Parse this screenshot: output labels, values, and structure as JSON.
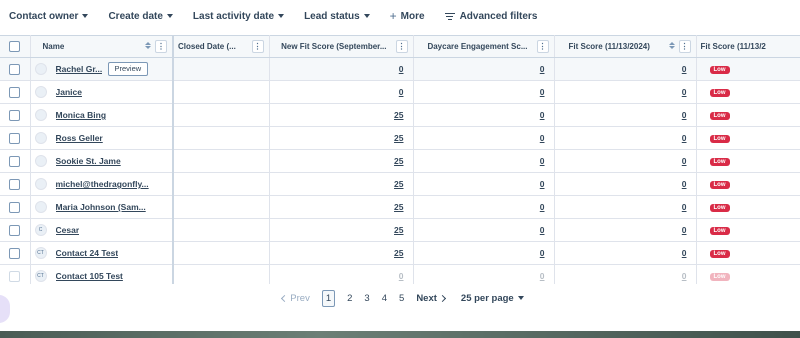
{
  "filters": [
    {
      "label": "Contact owner"
    },
    {
      "label": "Create date"
    },
    {
      "label": "Last activity date"
    },
    {
      "label": "Lead status"
    }
  ],
  "more_label": "More",
  "more_icon": "plus-icon",
  "advanced_label": "Advanced filters",
  "advanced_icon": "filter-lines-icon",
  "columns": {
    "name": "Name",
    "closed_date": "Closed Date (...",
    "new_fit": "New Fit Score (September...",
    "daycare": "Daycare Engagement Sc...",
    "fit_score": "Fit Score (11/13/2024)",
    "fit_score2": "Fit Score (11/13/2"
  },
  "preview_label": "Preview",
  "rows": [
    {
      "avatar": "",
      "name": "Rachel Gr...",
      "new_fit": "0",
      "daycare": "0",
      "fit": "0",
      "badge": "Low"
    },
    {
      "avatar": "",
      "name": "Janice",
      "new_fit": "0",
      "daycare": "0",
      "fit": "0",
      "badge": "Low"
    },
    {
      "avatar": "",
      "name": "Monica Bing",
      "new_fit": "25",
      "daycare": "0",
      "fit": "0",
      "badge": "Low"
    },
    {
      "avatar": "",
      "name": "Ross Geller",
      "new_fit": "25",
      "daycare": "0",
      "fit": "0",
      "badge": "Low"
    },
    {
      "avatar": "",
      "name": "Sookie St. Jame",
      "new_fit": "25",
      "daycare": "0",
      "fit": "0",
      "badge": "Low"
    },
    {
      "avatar": "",
      "name": "michel@thedragonfly...",
      "new_fit": "25",
      "daycare": "0",
      "fit": "0",
      "badge": "Low"
    },
    {
      "avatar": "",
      "name": "Maria Johnson (Sam...",
      "new_fit": "25",
      "daycare": "0",
      "fit": "0",
      "badge": "Low"
    },
    {
      "avatar": "C",
      "name": "Cesar",
      "new_fit": "25",
      "daycare": "0",
      "fit": "0",
      "badge": "Low"
    },
    {
      "avatar": "CT",
      "name": "Contact 24 Test",
      "new_fit": "25",
      "daycare": "0",
      "fit": "0",
      "badge": "Low"
    },
    {
      "avatar": "CT",
      "name": "Contact 105 Test",
      "new_fit": "0",
      "daycare": "0",
      "fit": "0",
      "badge": "Low"
    }
  ],
  "pagination": {
    "prev": "Prev",
    "pages": [
      "1",
      "2",
      "3",
      "4",
      "5"
    ],
    "current": "1",
    "next": "Next",
    "per_page": "25 per page"
  },
  "colors": {
    "accent": "#33475b",
    "badge": "#d92b47"
  }
}
